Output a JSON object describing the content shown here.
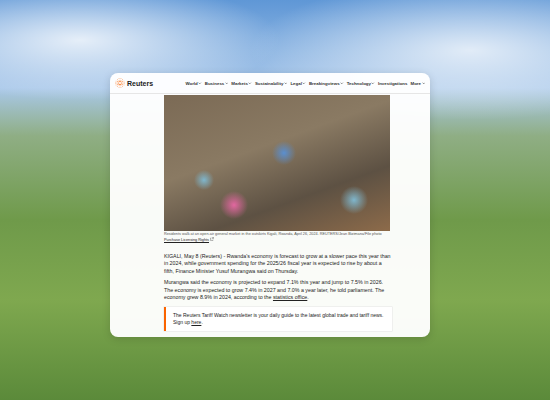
{
  "site": {
    "logo": "Reuters"
  },
  "nav": [
    {
      "label": "World",
      "dropdown": true
    },
    {
      "label": "Business",
      "dropdown": true
    },
    {
      "label": "Markets",
      "dropdown": true
    },
    {
      "label": "Sustainability",
      "dropdown": true
    },
    {
      "label": "Legal",
      "dropdown": true
    },
    {
      "label": "Breakingviews",
      "dropdown": true
    },
    {
      "label": "Technology",
      "dropdown": true
    },
    {
      "label": "Investigations",
      "dropdown": false
    },
    {
      "label": "More",
      "dropdown": true
    }
  ],
  "photo": {
    "caption": "Residents walk at an open-air general market in the outskirts Kigali, Rwanda, April 26, 2024. REUTERS/Jean Bizimana/File photo",
    "link": "Purchase Licensing Rights"
  },
  "paragraphs": [
    [
      {
        "text": "KIGALI, May 8 (Reuters) - Rwanda's economy is forecast to grow at a slower pace this year than in 2024, while government spending for the 2025/26 fiscal year is expected to rise by about a fifth, Finance Minister Yusuf Murangwa said on Thursday.",
        "link": false
      }
    ],
    [
      {
        "text": "Murangwa said the economy is projected to expand 7.1% this year and jump to 7.5% in 2026. The economy is expected to grow 7.4% in 2027 and 7.0% a year later, he told parliament. The economy grew 8.9% in 2024, according to the ",
        "link": false
      },
      {
        "text": "statistics office",
        "link": true
      },
      {
        "text": ".",
        "link": false
      }
    ]
  ],
  "newsletter": [
    {
      "text": "The Reuters Tariff Watch newsletter is your daily guide to the latest global trade and tariff news. Sign up ",
      "link": false
    },
    {
      "text": "here",
      "link": true
    },
    {
      "text": ".",
      "link": false
    }
  ]
}
